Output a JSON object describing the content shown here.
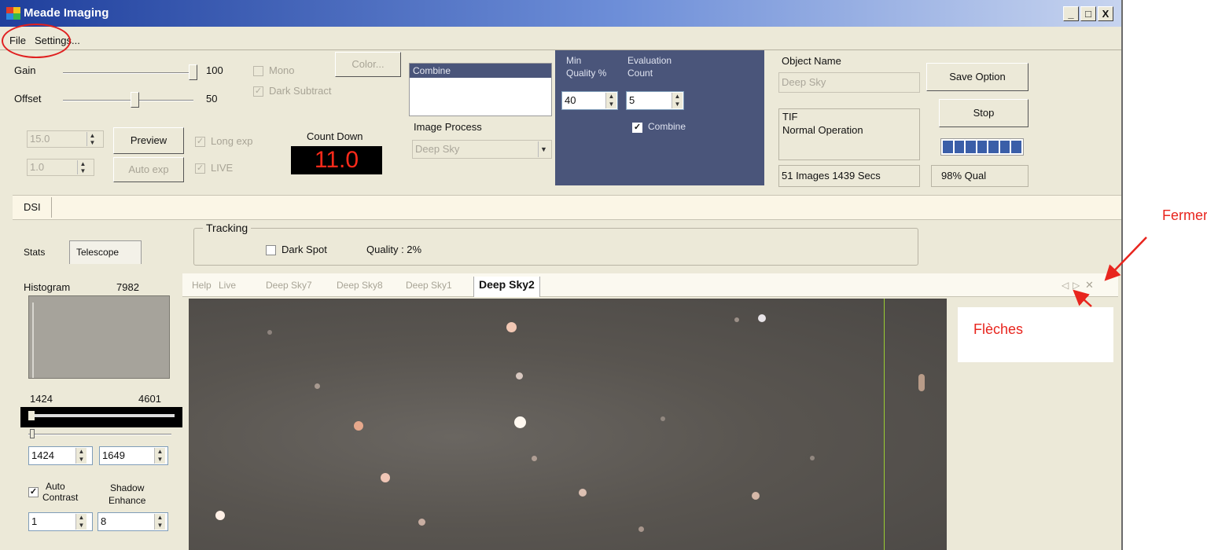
{
  "window": {
    "title": "Meade Imaging"
  },
  "title_controls": {
    "minimize": "_",
    "maximize": "□",
    "close": "X"
  },
  "menu": {
    "file": "File",
    "settings": "Settings..."
  },
  "controls": {
    "gain_label": "Gain",
    "gain_value": "100",
    "offset_label": "Offset",
    "offset_value": "50",
    "mono_label": "Mono",
    "dark_subtract_label": "Dark Subtract",
    "color_button": "Color...",
    "exposure_value": "15.0",
    "exposure2_value": "1.0",
    "preview_button": "Preview",
    "autoexp_button": "Auto exp",
    "long_exp_label": "Long exp",
    "live_label": "LIVE",
    "countdown_label": "Count Down",
    "countdown_value": "11.0"
  },
  "combine_list": {
    "item": "Combine"
  },
  "image_process": {
    "label": "Image Process",
    "value": "Deep Sky"
  },
  "evaluation": {
    "min_quality_label_1": "Min",
    "min_quality_label_2": "Quality %",
    "eval_count_label_1": "Evaluation",
    "eval_count_label_2": "Count",
    "min_quality_value": "40",
    "eval_count_value": "5",
    "combine_label": "Combine"
  },
  "object": {
    "name_label": "Object Name",
    "name_value": "Deep Sky",
    "format": "TIF",
    "status": "Normal Operation",
    "images_info": "51 Images 1439 Secs",
    "quality_info": "98% Qual"
  },
  "buttons": {
    "save_option": "Save Option",
    "stop": "Stop"
  },
  "progress": {
    "filled_segments": 7,
    "total_segments": 7
  },
  "dsi_label": "DSI",
  "side_tabs": {
    "stats": "Stats",
    "telescope": "Telescope"
  },
  "histogram": {
    "label": "Histogram",
    "value": "7982",
    "min": "1424",
    "max": "4601",
    "low_value": "1424",
    "high_value": "1649",
    "auto_contrast_1": "Auto",
    "auto_contrast_2": "Contrast",
    "shadow_1": "Shadow",
    "shadow_2": "Enhance",
    "contrast_value": "1",
    "shadow_value": "8"
  },
  "tracking": {
    "title": "Tracking",
    "dark_spot_label": "Dark Spot",
    "quality": "Quality : 2%"
  },
  "image_tabs": [
    "Help",
    "Live",
    "Deep Sky7",
    "Deep Sky8",
    "Deep Sky1",
    "Deep Sky2"
  ],
  "tab_nav": {
    "prev": "◁",
    "next": "▷",
    "close": "✕"
  },
  "annotations": {
    "close": "Fermer",
    "arrows": "Flèches",
    "color": "#e8251e"
  },
  "colors": {
    "title_bar": "#1f3f9c",
    "eval_panel": "#4a557a",
    "countdown_bg": "#000000",
    "countdown_text": "#ff2a1a"
  }
}
